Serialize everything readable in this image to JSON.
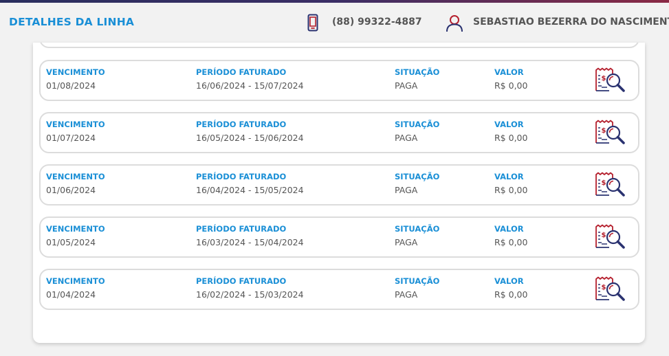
{
  "header": {
    "title": "DETALHES DA LINHA",
    "phone_icon": "smartphone-icon",
    "phone_number": "(88) 99322-4887",
    "user_icon": "user-icon",
    "user_name": "SEBASTIAO BEZERRA DO NASCIMENTO"
  },
  "colors": {
    "accent": "#1a8fd6",
    "brand_red": "#b5202e",
    "brand_navy": "#2a3270",
    "text": "#555555"
  },
  "labels": {
    "due": "VENCIMENTO",
    "period": "PERÍODO FATURADO",
    "status": "SITUAÇÃO",
    "amount": "VALOR"
  },
  "invoices": [
    {
      "due": "01/08/2024",
      "period": "16/06/2024 - 15/07/2024",
      "status": "PAGA",
      "amount": "R$ 0,00",
      "icon": "invoice-search-icon"
    },
    {
      "due": "01/07/2024",
      "period": "16/05/2024 - 15/06/2024",
      "status": "PAGA",
      "amount": "R$ 0,00",
      "icon": "invoice-search-icon"
    },
    {
      "due": "01/06/2024",
      "period": "16/04/2024 - 15/05/2024",
      "status": "PAGA",
      "amount": "R$ 0,00",
      "icon": "invoice-search-icon"
    },
    {
      "due": "01/05/2024",
      "period": "16/03/2024 - 15/04/2024",
      "status": "PAGA",
      "amount": "R$ 0,00",
      "icon": "invoice-search-icon"
    },
    {
      "due": "01/04/2024",
      "period": "16/02/2024 - 15/03/2024",
      "status": "PAGA",
      "amount": "R$ 0,00",
      "icon": "invoice-search-icon"
    }
  ]
}
